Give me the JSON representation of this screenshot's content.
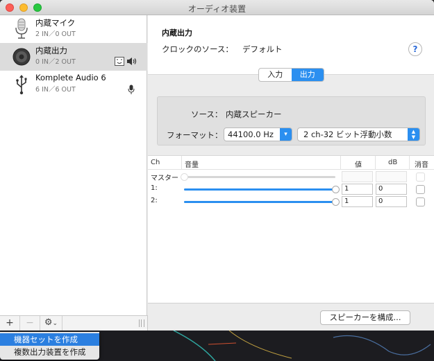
{
  "window": {
    "title": "オーディオ装置"
  },
  "devices": [
    {
      "name": "内蔵マイク",
      "io": "2 IN／0 OUT",
      "icon": "microphone-icon",
      "selected": false
    },
    {
      "name": "内蔵出力",
      "io": "0 IN／2 OUT",
      "icon": "speaker-icon",
      "selected": true
    },
    {
      "name": "Komplete Audio 6",
      "io": "6 IN／6 OUT",
      "icon": "usb-icon",
      "selected": false
    }
  ],
  "sidebar_toolbar": {
    "add": "+",
    "remove": "−",
    "gear": "⚙",
    "gear_chevron": "⌄"
  },
  "detail": {
    "device_title": "内蔵出力",
    "clock_label": "クロックのソース：",
    "clock_value": "デフォルト",
    "help": "?"
  },
  "tabs": {
    "input": "入力",
    "output": "出力",
    "selected": "output"
  },
  "format": {
    "source_label": "ソース：",
    "source_value": "内蔵スピーカー",
    "format_label": "フォーマット：",
    "rate": "44100.0 Hz",
    "bits": "2 ch-32 ビット浮動小数"
  },
  "volume": {
    "headers": {
      "ch": "Ch",
      "volume": "音量",
      "value": "値",
      "db": "dB",
      "mute": "消音"
    },
    "rows": [
      {
        "label": "マスター",
        "level": 0,
        "value": "",
        "db": "",
        "enabled": false
      },
      {
        "label": "1:",
        "level": 1,
        "value": "1",
        "db": "0",
        "enabled": true
      },
      {
        "label": "2:",
        "level": 1,
        "value": "1",
        "db": "0",
        "enabled": true
      }
    ]
  },
  "configure_button": "スピーカーを構成...",
  "menu": {
    "items": [
      "機器セットを作成",
      "複数出力装置を作成"
    ],
    "highlighted": 0
  },
  "colors": {
    "accent": "#2b8ff0",
    "selection": "#dcdcdc"
  }
}
